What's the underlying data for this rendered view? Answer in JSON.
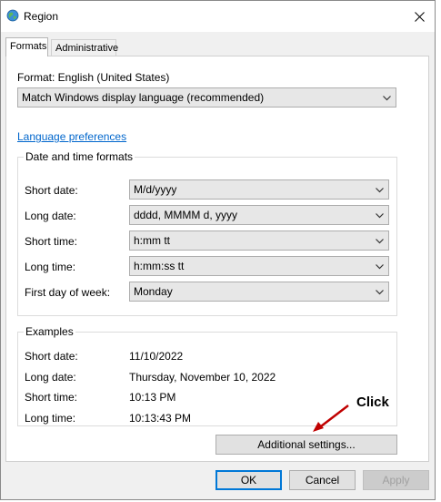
{
  "window": {
    "title": "Region",
    "close_label": "✕"
  },
  "tabs": [
    {
      "label": "Formats",
      "active": true
    },
    {
      "label": "Administrative",
      "active": false
    }
  ],
  "format": {
    "label": "Format: English (United States)",
    "selected": "Match Windows display language (recommended)"
  },
  "language_link": "Language preferences",
  "date_time_formats": {
    "title": "Date and time formats",
    "rows": [
      {
        "label": "Short date:",
        "value": "M/d/yyyy"
      },
      {
        "label": "Long date:",
        "value": "dddd, MMMM d, yyyy"
      },
      {
        "label": "Short time:",
        "value": "h:mm tt"
      },
      {
        "label": "Long time:",
        "value": "h:mm:ss tt"
      },
      {
        "label": "First day of week:",
        "value": "Monday"
      }
    ]
  },
  "examples": {
    "title": "Examples",
    "rows": [
      {
        "label": "Short date:",
        "value": "11/10/2022"
      },
      {
        "label": "Long date:",
        "value": "Thursday, November 10, 2022"
      },
      {
        "label": "Short time:",
        "value": "10:13 PM"
      },
      {
        "label": "Long time:",
        "value": "10:13:43 PM"
      }
    ]
  },
  "additional_settings_label": "Additional settings...",
  "annotation": {
    "text": "Click",
    "color": "#c00000"
  },
  "buttons": {
    "ok": "OK",
    "cancel": "Cancel",
    "apply": "Apply"
  },
  "colors": {
    "link": "#0066cc",
    "focus_border": "#0078d7",
    "dialog_bg": "#f0f0f0"
  }
}
